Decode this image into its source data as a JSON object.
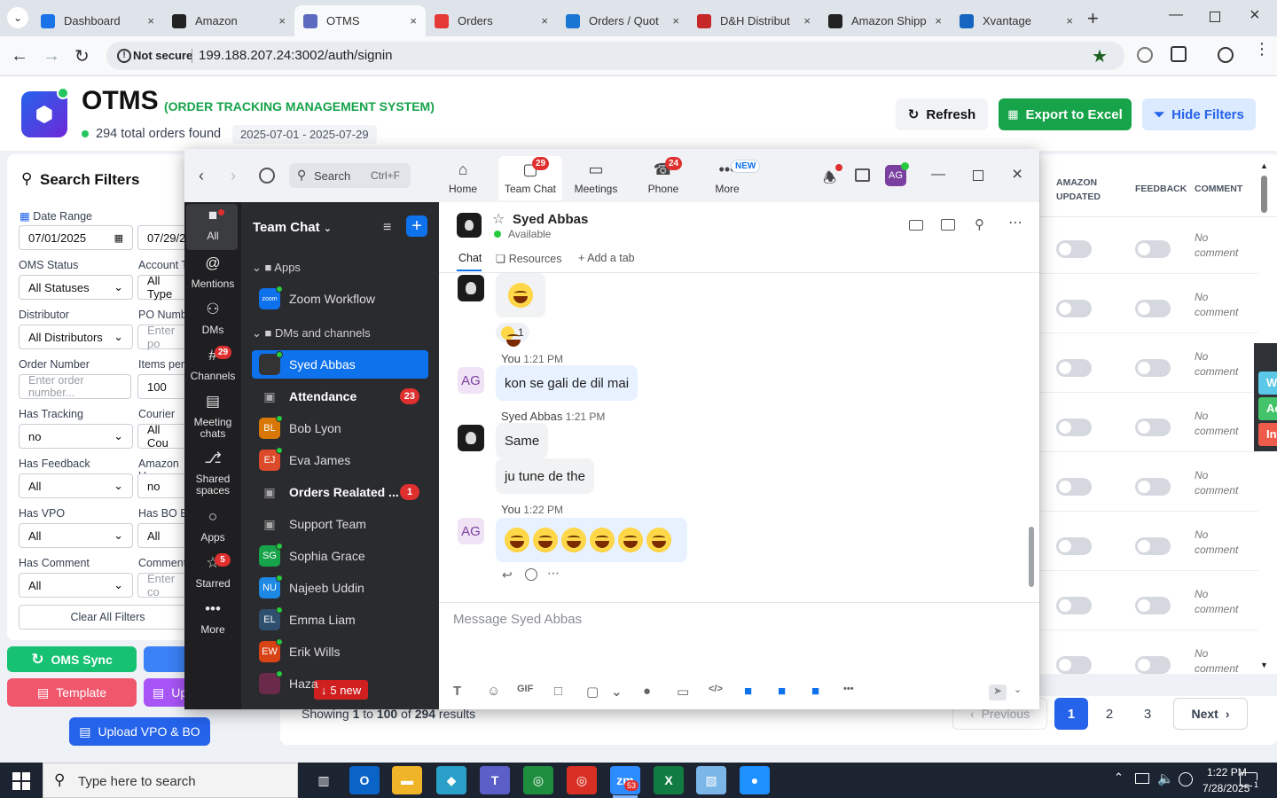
{
  "browser": {
    "tabs": [
      {
        "title": "Dashboard",
        "icon": "globe-icon",
        "color": "#1a73e8"
      },
      {
        "title": "Amazon",
        "icon": "amazon-icon",
        "color": "#222222"
      },
      {
        "title": "OTMS",
        "icon": "otms-icon",
        "color": "#5c6bc0"
      },
      {
        "title": "Orders",
        "icon": "orders-icon",
        "color": "#e53935"
      },
      {
        "title": "Orders / Quot",
        "icon": "ec-icon",
        "color": "#1976d2"
      },
      {
        "title": "D&H Distribut",
        "icon": "dh-icon",
        "color": "#c62828"
      },
      {
        "title": "Amazon Shipp",
        "icon": "amazon-icon",
        "color": "#222222"
      },
      {
        "title": "Xvantage",
        "icon": "xvantage-icon",
        "color": "#1565c0"
      }
    ],
    "not_secure": "Not secure",
    "url": "199.188.207.24:3002/auth/signin"
  },
  "app": {
    "title": "OTMS",
    "subtitle": "(ORDER TRACKING MANAGEMENT SYSTEM)",
    "orders_found": "294 total orders found",
    "date_range": "2025-07-01 - 2025-07-29",
    "refresh": "Refresh",
    "export": "Export to Excel",
    "hide_filters": "Hide Filters",
    "accent": "#16a34a",
    "brand": "#4f46e5"
  },
  "filters": {
    "title": "Search Filters",
    "date_range_label": "Date Range",
    "date_from": "07/01/2025",
    "date_to": "07/29/2",
    "oms_status_label": "OMS Status",
    "oms_status": "All Statuses",
    "account_label": "Account T",
    "account": "All Type",
    "distributor_label": "Distributor",
    "distributor": "All Distributors",
    "po_label": "PO Numb",
    "po_placeholder": "Enter po",
    "order_label": "Order Number",
    "order_placeholder": "Enter order number...",
    "items_label": "Items per",
    "items": "100",
    "tracking_label": "Has Tracking",
    "tracking": "no",
    "courier_label": "Courier",
    "courier": "All Cou",
    "feedback_label": "Has Feedback",
    "feedback": "All",
    "amazon_label": "Amazon U",
    "amazon": "no",
    "vpo_label": "Has VPO",
    "vpo": "All",
    "bo_label": "Has BO E",
    "bo": "All",
    "comment_label": "Has Comment",
    "comment": "All",
    "comment2_label": "Comment",
    "comment2_placeholder": "Enter co",
    "clear": "Clear All Filters"
  },
  "actions": {
    "oms_sync": "OMS Sync",
    "template": "Template",
    "upload_short": "Up",
    "upload_vpo": "Upload VPO & BO"
  },
  "table": {
    "col_amazon": "AMAZON UPDATED",
    "col_feedback": "FEEDBACK",
    "col_comment": "COMMENT",
    "no_comment": "No comment",
    "row_count": 8,
    "side_tags": [
      "W",
      "Ac",
      "In"
    ]
  },
  "pagination": {
    "showing_prefix": "Showing ",
    "from": "1",
    "to_word": " to ",
    "to": "100",
    "of_word": " of ",
    "total": "294",
    "suffix": " results",
    "previous": "Previous",
    "pages": [
      "1",
      "2",
      "3"
    ],
    "next": "Next"
  },
  "zoom": {
    "search": "Search",
    "shortcut": "Ctrl+F",
    "tabs": [
      {
        "label": "Home",
        "icon": "home-icon",
        "badge": ""
      },
      {
        "label": "Team Chat",
        "icon": "chat-icon",
        "badge": "29"
      },
      {
        "label": "Meetings",
        "icon": "video-icon",
        "badge": ""
      },
      {
        "label": "Phone",
        "icon": "phone-icon",
        "badge": "24"
      },
      {
        "label": "More",
        "icon": "more-icon",
        "badge": "NEW"
      }
    ],
    "profile_initials": "AG",
    "rail": [
      {
        "label": "All",
        "icon": "all-chat-icon",
        "badge": ""
      },
      {
        "label": "Mentions",
        "icon": "at-icon",
        "badge": ""
      },
      {
        "label": "DMs",
        "icon": "dms-icon",
        "badge": ""
      },
      {
        "label": "Channels",
        "icon": "hash-icon",
        "badge": "29"
      },
      {
        "label": "Meeting chats",
        "icon": "calendar-icon",
        "badge": ""
      },
      {
        "label": "Shared spaces",
        "icon": "shared-icon",
        "badge": ""
      },
      {
        "label": "Apps",
        "icon": "apps-icon",
        "badge": ""
      },
      {
        "label": "Starred",
        "icon": "star-icon",
        "badge": "5"
      },
      {
        "label": "More",
        "icon": "ellipsis-icon",
        "badge": ""
      }
    ],
    "list_title": "Team Chat",
    "apps_section": "Apps",
    "zoom_workflow": "Zoom Workflow",
    "dms_section": "DMs and channels",
    "contacts": [
      {
        "name": "Syed Abbas",
        "initials": "",
        "color": "#333333",
        "selected": true,
        "bold": false,
        "count": ""
      },
      {
        "name": "Attendance",
        "initials": "",
        "color": "#444444",
        "selected": false,
        "bold": true,
        "count": "23"
      },
      {
        "name": "Bob Lyon",
        "initials": "BL",
        "color": "#d97706",
        "selected": false,
        "bold": false,
        "count": ""
      },
      {
        "name": "Eva James",
        "initials": "EJ",
        "color": "#dc4a2a",
        "selected": false,
        "bold": false,
        "count": ""
      },
      {
        "name": "Orders Realated ...",
        "initials": "",
        "color": "#444444",
        "selected": false,
        "bold": true,
        "count": "1"
      },
      {
        "name": "Support Team",
        "initials": "",
        "color": "#444444",
        "selected": false,
        "bold": false,
        "count": ""
      },
      {
        "name": "Sophia Grace",
        "initials": "SG",
        "color": "#16a34a",
        "selected": false,
        "bold": false,
        "count": ""
      },
      {
        "name": "Najeeb Uddin",
        "initials": "NU",
        "color": "#1e88e5",
        "selected": false,
        "bold": false,
        "count": ""
      },
      {
        "name": "Emma Liam",
        "initials": "EL",
        "color": "#2f4f6f",
        "selected": false,
        "bold": false,
        "count": ""
      },
      {
        "name": "Erik Wills",
        "initials": "EW",
        "color": "#d84315",
        "selected": false,
        "bold": false,
        "count": ""
      },
      {
        "name": "Haza",
        "initials": "",
        "color": "#6b2a4a",
        "selected": false,
        "bold": false,
        "count": ""
      }
    ],
    "new_badge": "5 new",
    "chat_name": "Syed Abbas",
    "chat_status": "Available",
    "chat_tab": "Chat",
    "resources_tab": "Resources",
    "add_tab": "Add a tab",
    "reaction_count": "1",
    "messages": [
      {
        "sender": "You",
        "time": "1:21 PM",
        "text": "kon se gali de dil mai"
      },
      {
        "sender": "Syed Abbas",
        "time": "1:21 PM",
        "text": "Same"
      },
      {
        "sender": "",
        "time": "",
        "text": "ju tune de the"
      },
      {
        "sender": "You",
        "time": "1:22 PM",
        "text": ""
      }
    ],
    "composer_placeholder": "Message Syed Abbas"
  },
  "taskbar": {
    "search_placeholder": "Type here to search",
    "time": "1:22 PM",
    "date": "7/28/2025",
    "notif_count": "1",
    "zoom_badge": "53"
  }
}
